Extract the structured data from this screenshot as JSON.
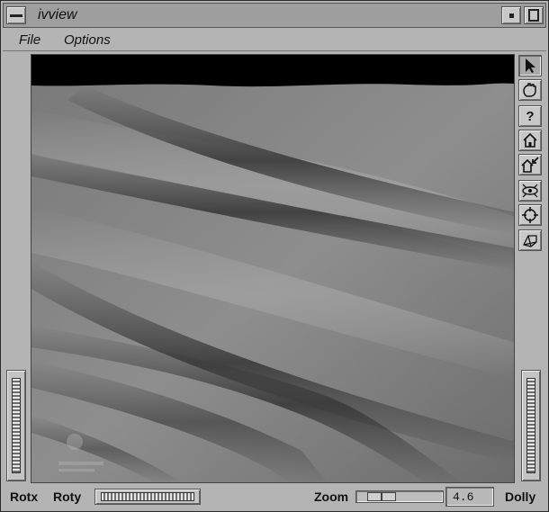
{
  "window": {
    "title": "ivview"
  },
  "menubar": {
    "items": [
      "File",
      "Options"
    ]
  },
  "toolbar": {
    "buttons": [
      {
        "icon": "arrow-pointer-icon",
        "tooltip": ""
      },
      {
        "icon": "hand-icon"
      },
      {
        "icon": "help-icon",
        "glyph": "?"
      },
      {
        "icon": "home-icon"
      },
      {
        "icon": "set-home-icon"
      },
      {
        "icon": "view-all-icon"
      },
      {
        "icon": "seek-icon"
      },
      {
        "icon": "perspective-icon"
      }
    ]
  },
  "bottombar": {
    "rotx_label": "Rotx",
    "roty_label": "Roty",
    "zoom_label": "Zoom",
    "zoom_value": "4.6",
    "dolly_label": "Dolly"
  },
  "colors": {
    "frame": "#b4b4b4",
    "viewer_bg": "#000000"
  }
}
